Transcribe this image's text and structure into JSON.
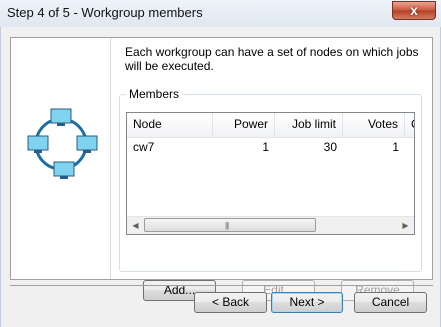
{
  "window": {
    "title": "Step 4 of 5 - Workgroup members",
    "close_glyph": "x"
  },
  "intro_text": "Each workgroup can have a set of nodes on which jobs will be executed.",
  "members": {
    "label": "Members",
    "columns": [
      "Node",
      "Power",
      "Job limit",
      "Votes",
      "C"
    ],
    "rows": [
      {
        "node": "cw7",
        "power": "1",
        "job_limit": "30",
        "votes": "1"
      }
    ],
    "scroll_left_glyph": "◀",
    "scroll_right_glyph": "▶",
    "scroll_grip": "|||"
  },
  "buttons": {
    "add": "Add...",
    "edit": "Edit...",
    "remove": "Remove",
    "back": "< Back",
    "next": "Next >",
    "cancel": "Cancel"
  },
  "graphic": {
    "icon": "network-ring-icon",
    "screen_color": "#7fd3ee",
    "ring_color": "#1c6ea4"
  }
}
